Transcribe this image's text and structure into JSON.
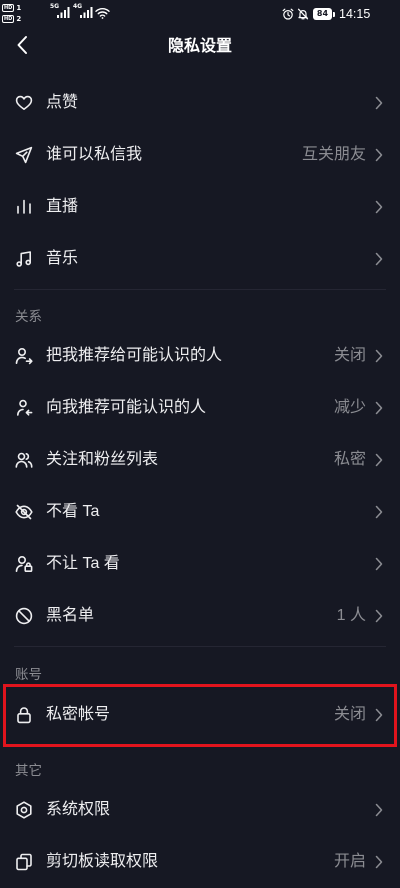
{
  "colors": {
    "background": "#161823",
    "text_primary": "#eeeef0",
    "text_secondary": "#8b8c92",
    "divider": "#252633",
    "highlight": "#e1141d"
  },
  "status_bar": {
    "sim1": {
      "badge": "HD",
      "slot": "1"
    },
    "sim2": {
      "badge": "HD",
      "slot": "2"
    },
    "signal_1": {
      "label": "5G",
      "icon": "signal-icon"
    },
    "signal_2": {
      "label": "4G",
      "icon": "signal-icon"
    },
    "wifi_icon": "wifi-icon",
    "alarm_icon": "alarm-icon",
    "mute_icon": "bell-off-icon",
    "battery_icon": "battery-icon",
    "battery_level": "84",
    "time": "14:15"
  },
  "header": {
    "back_icon": "chevron-left-icon",
    "title": "隐私设置"
  },
  "row_chevron_icon": "chevron-right-icon",
  "groups": [
    {
      "items": [
        {
          "icon": "heart-icon",
          "label": "点赞"
        },
        {
          "icon": "send-icon",
          "label": "谁可以私信我",
          "value": "互关朋友"
        },
        {
          "icon": "live-bars-icon",
          "label": "直播"
        },
        {
          "icon": "music-note-icon",
          "label": "音乐"
        }
      ]
    },
    {
      "title": "关系",
      "items": [
        {
          "icon": "person-share-icon",
          "label": "把我推荐给可能认识的人",
          "value": "关闭"
        },
        {
          "icon": "person-receive-icon",
          "label": "向我推荐可能认识的人",
          "value": "减少"
        },
        {
          "icon": "followers-icon",
          "label": "关注和粉丝列表",
          "value": "私密"
        },
        {
          "icon": "eye-off-icon",
          "label": "不看 Ta"
        },
        {
          "icon": "person-lock-icon",
          "label": "不让 Ta 看"
        },
        {
          "icon": "ban-icon",
          "label": "黑名单",
          "value": "1 人"
        }
      ]
    },
    {
      "title": "账号",
      "items": [
        {
          "icon": "lock-icon",
          "label": "私密帐号",
          "value": "关闭",
          "highlighted": true
        }
      ]
    },
    {
      "title": "其它",
      "items": [
        {
          "icon": "hexagon-settings-icon",
          "label": "系统权限"
        },
        {
          "icon": "clipboard-icon",
          "label": "剪切板读取权限",
          "value": "开启"
        }
      ]
    }
  ]
}
